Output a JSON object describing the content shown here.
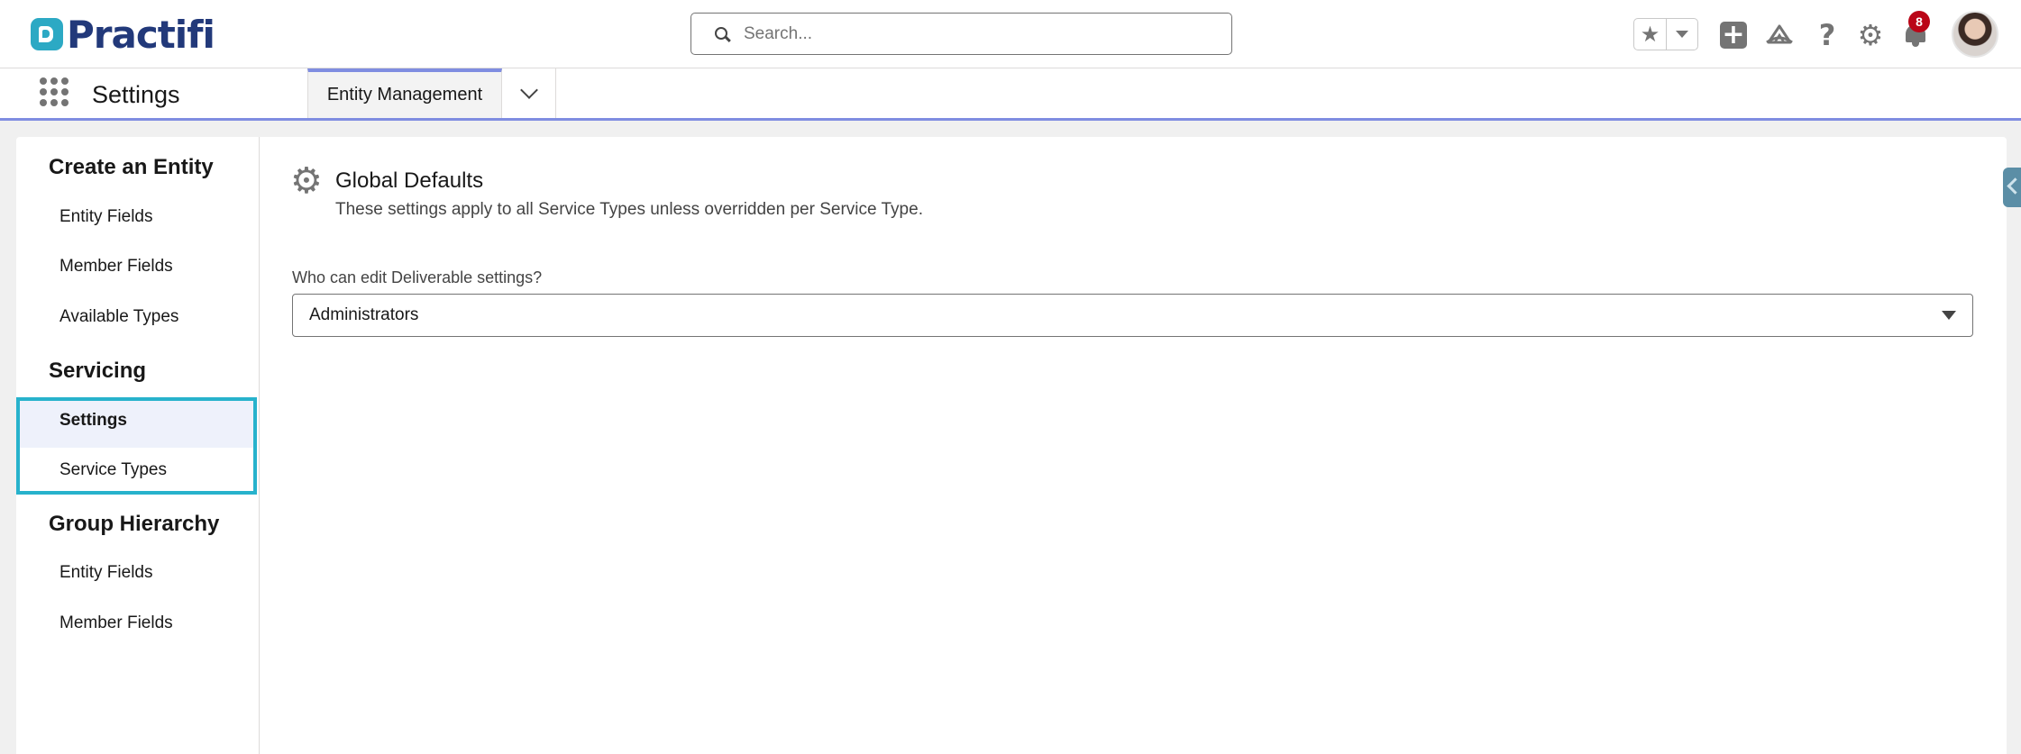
{
  "header": {
    "logo_text": "Practifi",
    "search_placeholder": "Search...",
    "notification_count": "8",
    "icons": [
      "star-icon",
      "chevron-down-icon",
      "plus-icon",
      "trailhead-icon",
      "help-icon",
      "gear-icon",
      "bell-icon"
    ]
  },
  "navbar": {
    "app_name": "Settings",
    "active_tab": "Entity Management"
  },
  "sidebar": {
    "sections": [
      {
        "title": "Create an Entity",
        "items": [
          "Entity Fields",
          "Member Fields",
          "Available Types"
        ]
      },
      {
        "title": "Servicing",
        "items": [
          "Settings",
          "Service Types"
        ]
      },
      {
        "title": "Group Hierarchy",
        "items": [
          "Entity Fields",
          "Member Fields"
        ]
      }
    ],
    "active_item": "Settings"
  },
  "main": {
    "title": "Global Defaults",
    "description": "These settings apply to all Service Types unless overridden per Service Type.",
    "field_label": "Who can edit Deliverable settings?",
    "field_value": "Administrators"
  },
  "colors": {
    "brand_navy": "#22397a",
    "brand_teal": "#2ca9c4",
    "nav_accent": "#7f8de1",
    "highlight_border": "#27b2cc",
    "badge_red": "#ba0517"
  }
}
